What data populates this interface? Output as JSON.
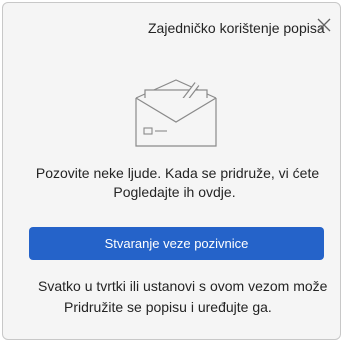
{
  "dialog": {
    "title": "Zajedničko korištenje popisa",
    "close_icon": "close-icon"
  },
  "illustration": {
    "icon": "envelope-checkmark-icon"
  },
  "body": {
    "invite_line1": "Pozovite neke ljude. Kada se pridruže, vi ćete",
    "invite_line2": "Pogledajte ih ovdje."
  },
  "actions": {
    "create_link_label": "Stvaranje veze pozivnice",
    "accent_color": "#2563c9"
  },
  "footer": {
    "line1": "Svatko u tvrtki ili ustanovi s ovom vezom može",
    "line2": "Pridružite se popisu i uređujte ga."
  }
}
